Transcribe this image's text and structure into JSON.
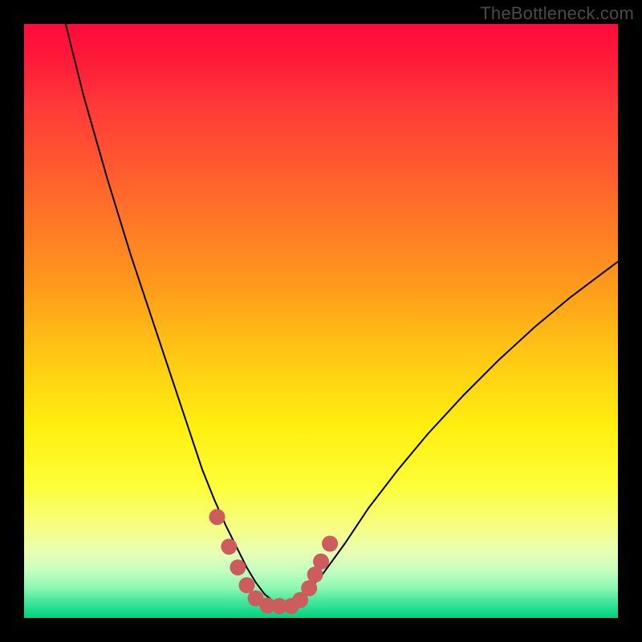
{
  "watermark": "TheBottleneck.com",
  "chart_data": {
    "type": "line",
    "title": "",
    "xlabel": "",
    "ylabel": "",
    "xlim": [
      0,
      100
    ],
    "ylim": [
      0,
      100
    ],
    "series": [
      {
        "name": "bottleneck-curve",
        "x": [
          7,
          10,
          14,
          18,
          22,
          25,
          28,
          30,
          32,
          34,
          36,
          37.5,
          39,
          40.5,
          42,
          43.5,
          45,
          47,
          50,
          54,
          58,
          63,
          68,
          74,
          80,
          86,
          92,
          98,
          100
        ],
        "y": [
          100,
          88,
          74,
          61,
          49,
          40,
          31,
          25,
          20,
          15.5,
          11.5,
          8.5,
          6,
          4,
          2.8,
          2.2,
          2.5,
          3.8,
          7,
          12.5,
          18.5,
          25,
          31,
          37.5,
          43.5,
          49,
          54,
          58.5,
          60
        ]
      }
    ],
    "marker_points": {
      "name": "highlight-dots",
      "color": "#cd5c5c",
      "points": [
        {
          "x": 32.5,
          "y": 17
        },
        {
          "x": 34.5,
          "y": 12
        },
        {
          "x": 36,
          "y": 8.5
        },
        {
          "x": 37.5,
          "y": 5.5
        },
        {
          "x": 39,
          "y": 3.3
        },
        {
          "x": 41,
          "y": 2.1
        },
        {
          "x": 43,
          "y": 2.0
        },
        {
          "x": 45,
          "y": 2.0
        },
        {
          "x": 46.5,
          "y": 3.0
        },
        {
          "x": 48,
          "y": 5.0
        },
        {
          "x": 49,
          "y": 7.3
        },
        {
          "x": 50,
          "y": 9.5
        },
        {
          "x": 51.5,
          "y": 12.5
        }
      ]
    },
    "background_gradient": {
      "orientation": "vertical",
      "stops": [
        {
          "pos": 0.0,
          "color": "#ff0a3c"
        },
        {
          "pos": 0.5,
          "color": "#ffc814"
        },
        {
          "pos": 0.8,
          "color": "#fdfe3a"
        },
        {
          "pos": 1.0,
          "color": "#02d27f"
        }
      ]
    }
  }
}
